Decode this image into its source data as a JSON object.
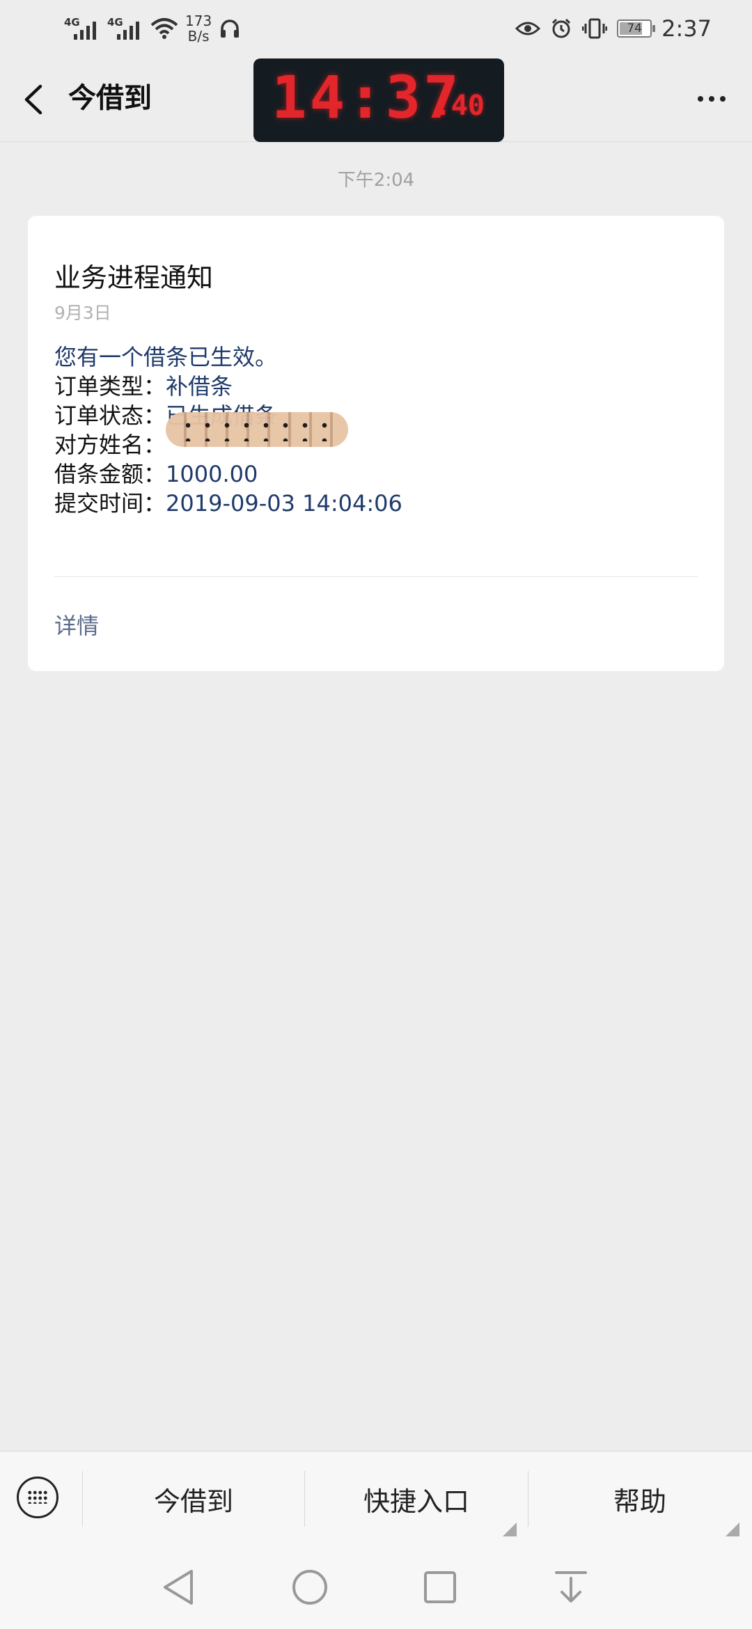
{
  "status_bar": {
    "network_left": "4G",
    "network_right": "4G",
    "speed_value": "173",
    "speed_unit": "B/s",
    "battery": "74",
    "time": "2:37"
  },
  "overlay_clock": {
    "hours": "14",
    "minutes": "37",
    "seconds": "40"
  },
  "header": {
    "title": "今借到"
  },
  "timestamp": "下午2:04",
  "card": {
    "title": "业务进程通知",
    "date": "9月3日",
    "intro": "您有一个借条已生效。",
    "rows": [
      {
        "label": "订单类型：",
        "value": "补借条"
      },
      {
        "label": "订单状态：",
        "value": "已生成借条"
      },
      {
        "label": "对方姓名：",
        "value": ""
      },
      {
        "label": "借条金额：",
        "value": "1000.00"
      },
      {
        "label": "提交时间：",
        "value": "2019-09-03 14:04:06"
      }
    ],
    "detail_link": "详情"
  },
  "menu": {
    "items": [
      "今借到",
      "快捷入口",
      "帮助"
    ]
  },
  "icons": {
    "back": "chevron-left-icon",
    "more": "more-icon",
    "keyboard": "keyboard-icon"
  },
  "colors": {
    "led": "#e3262b",
    "value_text": "#1f3a6a",
    "link": "#5b6b8c"
  }
}
